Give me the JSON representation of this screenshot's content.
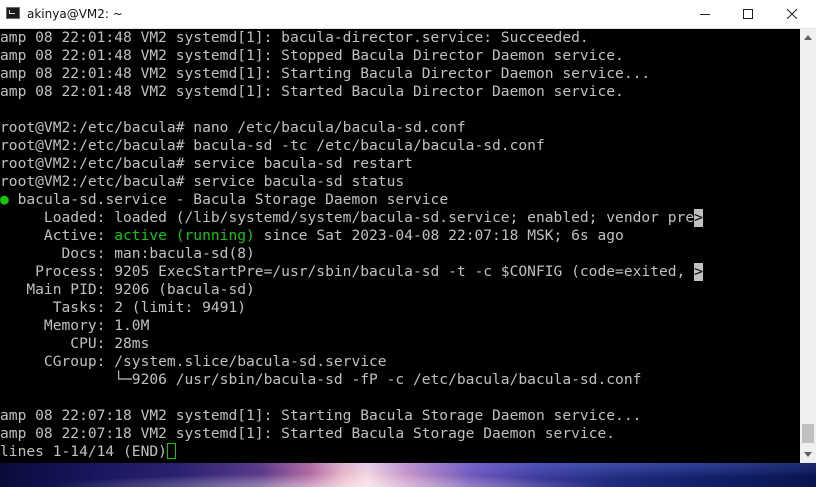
{
  "window": {
    "title": "akinya@VM2: ~",
    "buttons": {
      "minimize": "minimize-icon",
      "maximize": "maximize-icon",
      "close": "close-icon"
    }
  },
  "terminal": {
    "lines": [
      "amp 08 22:01:48 VM2 systemd[1]: bacula-director.service: Succeeded.",
      "amp 08 22:01:48 VM2 systemd[1]: Stopped Bacula Director Daemon service.",
      "amp 08 22:01:48 VM2 systemd[1]: Starting Bacula Director Daemon service...",
      "amp 08 22:01:48 VM2 systemd[1]: Started Bacula Director Daemon service.",
      "",
      "root@VM2:/etc/bacula# nano /etc/bacula/bacula-sd.conf",
      "root@VM2:/etc/bacula# bacula-sd -tc /etc/bacula/bacula-sd.conf",
      "root@VM2:/etc/bacula# service bacula-sd restart",
      "root@VM2:/etc/bacula# service bacula-sd status"
    ],
    "service_dot": "●",
    "service_line": " bacula-sd.service - Bacula Storage Daemon service",
    "loaded_line": "     Loaded: loaded (/lib/systemd/system/bacula-sd.service; enabled; vendor pre",
    "active_prefix": "     Active: ",
    "active_status": "active (running)",
    "active_suffix": " since Sat 2023-04-08 22:07:18 MSK; 6s ago",
    "docs_line": "       Docs: man:bacula-sd(8)",
    "process_line": "    Process: 9205 ExecStartPre=/usr/sbin/bacula-sd -t -c $CONFIG (code=exited, ",
    "mainpid_line": "   Main PID: 9206 (bacula-sd)",
    "tasks_line": "      Tasks: 2 (limit: 9491)",
    "memory_line": "     Memory: 1.0M",
    "cpu_line": "        CPU: 28ms",
    "cgroup_line": "     CGroup: /system.slice/bacula-sd.service",
    "cgroup_child_line": "             └─9206 /usr/sbin/bacula-sd -fP -c /etc/bacula/bacula-sd.conf",
    "blank_line": "",
    "log_lines": [
      "amp 08 22:07:18 VM2 systemd[1]: Starting Bacula Storage Daemon service...",
      "amp 08 22:07:18 VM2 systemd[1]: Started Bacula Storage Daemon service."
    ],
    "truncation_marker": ">",
    "status_line": "lines 1-14/14 (END)"
  },
  "scrollbar": {
    "up": "scroll-up-arrow-icon",
    "down": "scroll-down-arrow-icon",
    "position": 0.95
  },
  "colors": {
    "terminal_bg": "#000000",
    "terminal_fg": "#c0c0c0",
    "green": "#16c60c"
  }
}
